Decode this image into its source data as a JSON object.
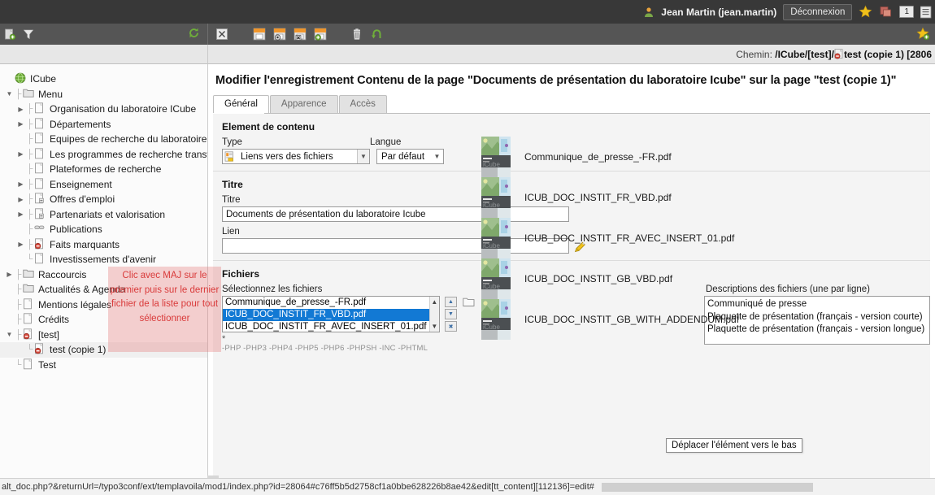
{
  "topbar": {
    "user_icon": "user-icon",
    "user_name": "Jean Martin (jean.martin)",
    "logout_label": "Déconnexion",
    "bookmark_icon": "star-icon",
    "clipboard_icon": "clipboard-icon",
    "counter": "1"
  },
  "toolbar": {
    "new_page_icon": "new-page-icon",
    "filter_icon": "filter-icon",
    "refresh_icon": "refresh-icon",
    "close_icon": "close-document-icon",
    "save_icon": "save-icon",
    "save_view_icon": "save-and-view-icon",
    "save_close_icon": "save-and-close-icon",
    "save_new_icon": "save-and-new-icon",
    "delete_icon": "trash-icon",
    "undo_icon": "undo-icon",
    "bookmark_icon": "star-add-icon"
  },
  "pathbar": {
    "label": "Chemin:",
    "path": "/ICube/[test]/",
    "page_icon": "page-icon",
    "page_name": "test (copie 1)",
    "page_id": "[2806"
  },
  "tree": {
    "root_label": "ICube",
    "items": [
      {
        "label": "Menu",
        "depth": 1,
        "icon": "folder-icon",
        "toggle": "open",
        "guide": "├"
      },
      {
        "label": "Organisation du laboratoire ICube",
        "depth": 2,
        "icon": "page-icon",
        "toggle": "closed",
        "guide": "├"
      },
      {
        "label": "Départements",
        "depth": 2,
        "icon": "page-icon",
        "toggle": "closed",
        "guide": "├"
      },
      {
        "label": "Equipes de recherche du laboratoire IC",
        "depth": 2,
        "icon": "page-icon",
        "toggle": "none",
        "guide": "├"
      },
      {
        "label": "Les programmes de recherche transve",
        "depth": 2,
        "icon": "page-icon",
        "toggle": "closed",
        "guide": "├"
      },
      {
        "label": "Plateformes de recherche",
        "depth": 2,
        "icon": "page-icon",
        "toggle": "none",
        "guide": "├"
      },
      {
        "label": "Enseignement",
        "depth": 2,
        "icon": "page-icon",
        "toggle": "closed",
        "guide": "├"
      },
      {
        "label": "Offres d'emploi",
        "depth": 2,
        "icon": "page-link-icon",
        "toggle": "closed",
        "guide": "├"
      },
      {
        "label": "Partenariats et valorisation",
        "depth": 2,
        "icon": "page-link-icon",
        "toggle": "closed",
        "guide": "├"
      },
      {
        "label": "Publications",
        "depth": 2,
        "icon": "link-icon",
        "toggle": "none",
        "guide": "├"
      },
      {
        "label": "Faits marquants",
        "depth": 2,
        "icon": "page-hidden-icon",
        "toggle": "closed",
        "guide": "├"
      },
      {
        "label": "Investissements d'avenir",
        "depth": 2,
        "icon": "page-icon",
        "toggle": "none",
        "guide": "└"
      },
      {
        "label": "Raccourcis",
        "depth": 1,
        "icon": "folder-icon",
        "toggle": "closed",
        "guide": "├"
      },
      {
        "label": "Actualités & Agenda",
        "depth": 1,
        "icon": "folder-icon",
        "toggle": "none",
        "guide": "├"
      },
      {
        "label": "Mentions légales",
        "depth": 1,
        "icon": "page-icon",
        "toggle": "none",
        "guide": "├"
      },
      {
        "label": "Crédits",
        "depth": 1,
        "icon": "page-icon",
        "toggle": "none",
        "guide": "├"
      },
      {
        "label": "[test]",
        "depth": 1,
        "icon": "page-hidden-icon",
        "toggle": "open",
        "guide": "├"
      },
      {
        "label": "test (copie 1)",
        "depth": 2,
        "icon": "page-hidden-icon",
        "toggle": "none",
        "guide": "└",
        "selected": true
      },
      {
        "label": "Test",
        "depth": 1,
        "icon": "page-icon",
        "toggle": "none",
        "guide": "└"
      }
    ]
  },
  "annotation": {
    "text": "Clic avec MAJ sur le premier puis sur le dernier fichier de la liste pour tout sélectionner",
    "color": "#d93a3a",
    "background": "rgba(228,115,115,0.33)"
  },
  "main": {
    "title": "Modifier l'enregistrement Contenu de la page \"Documents de présentation du laboratoire Icube\" sur la page \"test (copie 1)\"",
    "tabs": [
      {
        "label": "Général",
        "active": true
      },
      {
        "label": "Apparence",
        "active": false
      },
      {
        "label": "Accès",
        "active": false
      }
    ],
    "section_content": {
      "heading": "Element de contenu",
      "type_label": "Type",
      "type_value": "Liens vers des fichiers",
      "lang_label": "Langue",
      "lang_value": "Par défaut"
    },
    "section_titre": {
      "heading": "Titre",
      "titre_label": "Titre",
      "titre_value": "Documents de présentation du laboratoire Icube",
      "lien_label": "Lien",
      "lien_value": "",
      "lien_icon": "link-browser-icon"
    },
    "section_fichiers": {
      "heading": "Fichiers",
      "select_label": "Sélectionnez les fichiers",
      "listbox_items": [
        {
          "label": "Communique_de_presse_-FR.pdf",
          "selected": false
        },
        {
          "label": "ICUB_DOC_INSTIT_FR_VBD.pdf",
          "selected": true
        },
        {
          "label": "ICUB_DOC_INSTIT_FR_AVEC_INSERT_01.pdf",
          "selected": false
        }
      ],
      "required_marker": "*",
      "extensions": "-PHP -PHP3 -PHP4 -PHP5 -PHP6 -PHPSH -INC -PHTML",
      "move_up_icon": "move-up-icon",
      "move_down_icon": "move-down-icon",
      "remove_icon": "remove-icon",
      "browse_icon": "folder-browse-icon",
      "tooltip": "Déplacer l'élément vers le bas",
      "files": [
        {
          "name": "Communique_de_presse_-FR.pdf"
        },
        {
          "name": "ICUB_DOC_INSTIT_FR_VBD.pdf"
        },
        {
          "name": "ICUB_DOC_INSTIT_FR_AVEC_INSERT_01.pdf"
        },
        {
          "name": "ICUB_DOC_INSTIT_GB_VBD.pdf"
        },
        {
          "name": "ICUB_DOC_INSTIT_GB_WITH_ADDENDUM.pdf"
        }
      ],
      "descriptions_label": "Descriptions des fichiers (une par ligne)",
      "descriptions_value": "Communiqué de presse\nPlaquette de présentation (français - version courte)\nPlaquette de présentation (français - version longue)"
    }
  },
  "statusbar": {
    "url": "alt_doc.php?&returnUrl=/typo3conf/ext/templavoila/mod1/index.php?id=28064#c76ff5b5d2758cf1a0bbe628226b8ae42&edit[tt_content][112136]=edit#"
  },
  "colors": {
    "topbar_bg": "#383838",
    "toolbar_bg": "#555555",
    "selection_blue": "#1279d4",
    "panel_bg": "#f4f4f4",
    "annotation_red": "#d93a3a"
  }
}
